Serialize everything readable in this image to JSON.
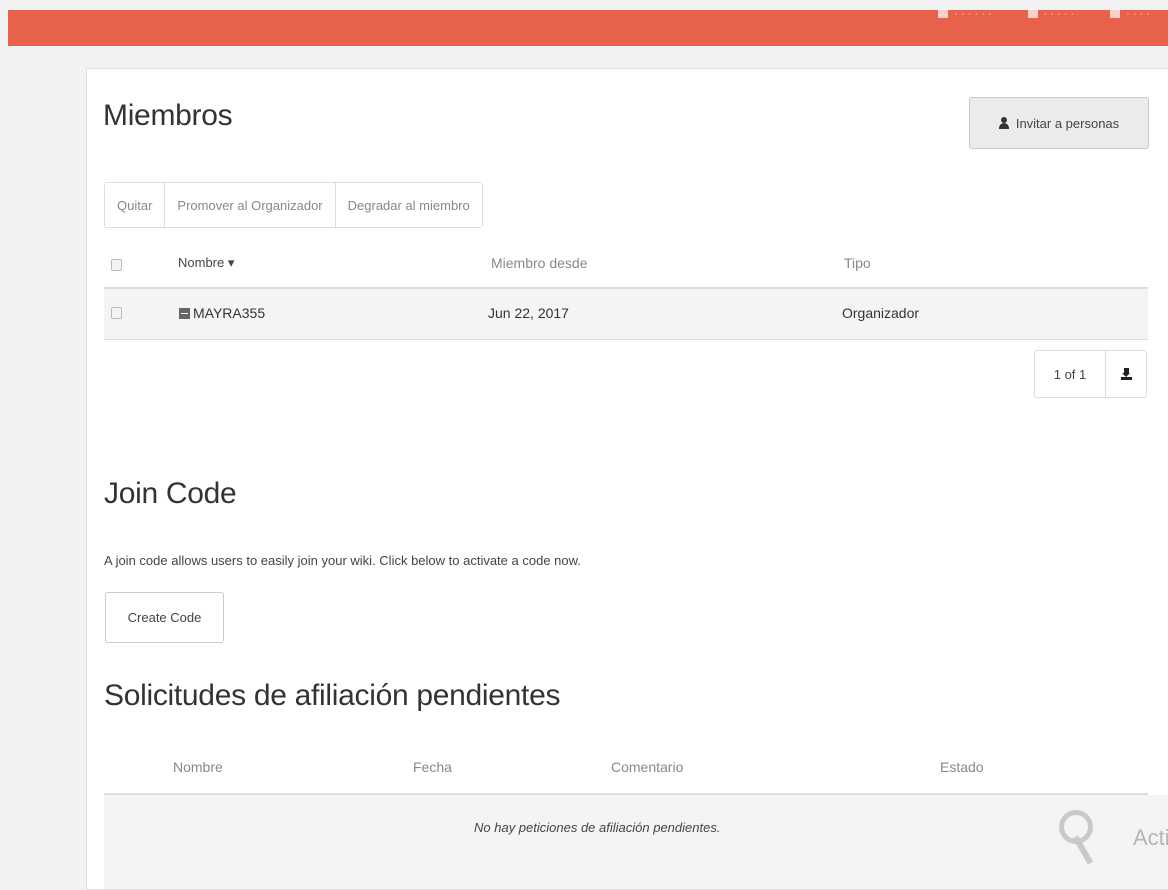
{
  "topbar": {
    "items": [
      {
        "icon": "square-icon",
        "label": "· · · · · ·"
      },
      {
        "icon": "square-icon",
        "label": "· · · · ·"
      },
      {
        "icon": "square-icon",
        "label": "· · · ·"
      }
    ],
    "color": "#e8614a"
  },
  "members": {
    "title": "Miembros",
    "invite_button": "Invitar a personas",
    "actions": [
      "Quitar",
      "Promover al Organizador",
      "Degradar al miembro"
    ],
    "columns": {
      "name": "Nombre ▾",
      "member_since": "Miembro desde",
      "type": "Tipo"
    },
    "rows": [
      {
        "name": "MAYRA355",
        "member_since": "Jun 22, 2017",
        "type": "Organizador"
      }
    ],
    "pager": "1 of 1"
  },
  "join_code": {
    "title": "Join Code",
    "description": "A join code allows users to easily join your wiki. Click below to activate a code now.",
    "button": "Create Code"
  },
  "requests": {
    "title": "Solicitudes de afiliación pendientes",
    "columns": {
      "name": "Nombre",
      "date": "Fecha",
      "comment": "Comentario",
      "status": "Estado"
    },
    "empty_message": "No hay peticiones de afiliación pendientes.",
    "watermark_text": "Activ"
  }
}
